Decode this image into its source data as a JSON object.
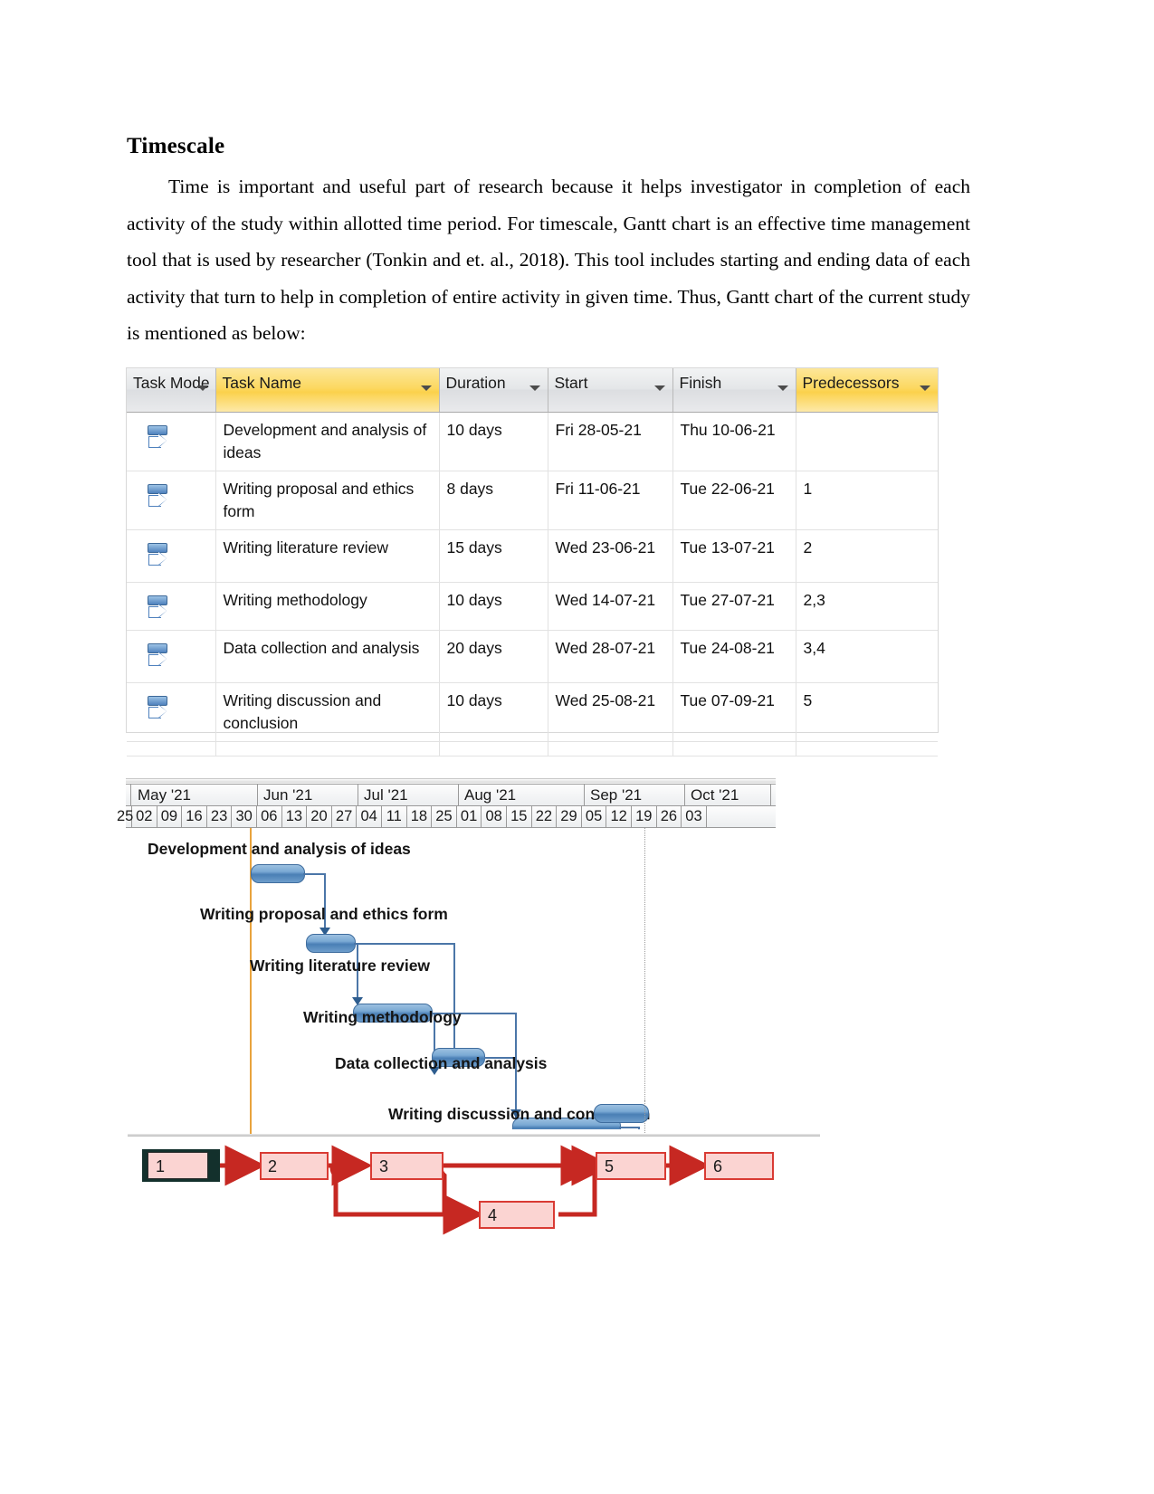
{
  "document": {
    "heading": "Timescale",
    "paragraph": "Time is important and useful part of research because it helps investigator in completion of each activity of the study within allotted time period. For timescale, Gantt chart is an effective time management tool that is used by researcher (Tonkin and et. al., 2018). This tool includes starting and ending data of each activity that turn to help in completion of entire activity in given time. Thus, Gantt chart of the current study is mentioned as below:"
  },
  "task_table": {
    "columns": [
      {
        "label": "Task Mode",
        "style": "gray"
      },
      {
        "label": "Task Name",
        "style": "yellow"
      },
      {
        "label": "Duration",
        "style": "gray"
      },
      {
        "label": "Start",
        "style": "gray"
      },
      {
        "label": "Finish",
        "style": "gray"
      },
      {
        "label": "Predecessors",
        "style": "yellow"
      }
    ],
    "rows": [
      {
        "mode": "auto-schedule",
        "name": "Development and analysis of ideas",
        "duration": "10 days",
        "start": "Fri 28-05-21",
        "finish": "Thu 10-06-21",
        "predecessors": ""
      },
      {
        "mode": "auto-schedule",
        "name": "Writing proposal and ethics form",
        "duration": "8 days",
        "start": "Fri 11-06-21",
        "finish": "Tue 22-06-21",
        "predecessors": "1"
      },
      {
        "mode": "auto-schedule",
        "name": "Writing literature review",
        "duration": "15 days",
        "start": "Wed 23-06-21",
        "finish": "Tue 13-07-21",
        "predecessors": "2"
      },
      {
        "mode": "auto-schedule",
        "name": "Writing methodology",
        "duration": "10 days",
        "start": "Wed 14-07-21",
        "finish": "Tue 27-07-21",
        "predecessors": "2,3"
      },
      {
        "mode": "auto-schedule",
        "name": "Data collection and analysis",
        "duration": "20 days",
        "start": "Wed 28-07-21",
        "finish": "Tue 24-08-21",
        "predecessors": "3,4"
      },
      {
        "mode": "auto-schedule",
        "name": "Writing discussion and conclusion",
        "duration": "10 days",
        "start": "Wed 25-08-21",
        "finish": "Tue 07-09-21",
        "predecessors": "5"
      }
    ]
  },
  "chart_data": {
    "type": "bar",
    "title": "Gantt chart of the current study",
    "xlabel": "",
    "ylabel": "",
    "months": [
      {
        "label": "May '21",
        "weeks": 5
      },
      {
        "label": "Jun '21",
        "weeks": 4
      },
      {
        "label": "Jul '21",
        "weeks": 4
      },
      {
        "label": "Aug '21",
        "weeks": 5
      },
      {
        "label": "Sep '21",
        "weeks": 4
      },
      {
        "label": "Oct '21",
        "weeks": 1
      }
    ],
    "week_ticks": [
      "25",
      "02",
      "09",
      "16",
      "23",
      "30",
      "06",
      "13",
      "20",
      "27",
      "04",
      "11",
      "18",
      "25",
      "01",
      "08",
      "15",
      "22",
      "29",
      "05",
      "12",
      "19",
      "26",
      "03"
    ],
    "categories": [
      "Development and analysis of ideas",
      "Writing proposal and ethics form",
      "Writing literature review",
      "Writing methodology",
      "Data collection and analysis",
      "Writing discussion and conclusion"
    ],
    "values": [
      10,
      8,
      15,
      10,
      20,
      10
    ],
    "bars": [
      {
        "label": "Development and analysis of ideas",
        "start": "Fri 28-05-21",
        "finish": "Thu 10-06-21",
        "duration_days": 10,
        "start_week_index": 4.45,
        "width_weeks": 1.95
      },
      {
        "label": "Writing proposal and ethics form",
        "start": "Fri 11-06-21",
        "finish": "Tue 22-06-21",
        "duration_days": 8,
        "start_week_index": 6.45,
        "width_weeks": 1.6
      },
      {
        "label": "Writing literature review",
        "start": "Wed 23-06-21",
        "finish": "Tue 13-07-21",
        "duration_days": 15,
        "start_week_index": 8.05,
        "width_weeks": 3.0
      },
      {
        "label": "Writing methodology",
        "start": "Wed 14-07-21",
        "finish": "Tue 27-07-21",
        "duration_days": 10,
        "start_week_index": 11.05,
        "width_weeks": 2.0
      },
      {
        "label": "Data collection and analysis",
        "start": "Wed 28-07-21",
        "finish": "Tue 24-08-21",
        "duration_days": 20,
        "start_week_index": 13.05,
        "width_weeks": 4.0
      },
      {
        "label": "Writing discussion and conclusion",
        "start": "Wed 25-08-21",
        "finish": "Tue 07-09-21",
        "duration_days": 10,
        "start_week_index": 17.05,
        "width_weeks": 2.0
      }
    ],
    "bar_color": "#4a7fb5",
    "link_color": "#4b76a8",
    "today_line_color": "#e8a33d",
    "grid": false,
    "legend": "none"
  },
  "network_diagram": {
    "node_fill": "#fbd4d2",
    "node_border": "#d93b34",
    "nodes": [
      {
        "id": "1",
        "label": "1",
        "critical_start": true
      },
      {
        "id": "2",
        "label": "2"
      },
      {
        "id": "3",
        "label": "3"
      },
      {
        "id": "4",
        "label": "4"
      },
      {
        "id": "5",
        "label": "5"
      },
      {
        "id": "6",
        "label": "6"
      }
    ],
    "edges": [
      {
        "from": "1",
        "to": "2"
      },
      {
        "from": "2",
        "to": "3"
      },
      {
        "from": "2",
        "to": "4"
      },
      {
        "from": "3",
        "to": "4"
      },
      {
        "from": "3",
        "to": "5"
      },
      {
        "from": "4",
        "to": "5"
      },
      {
        "from": "5",
        "to": "6"
      }
    ]
  }
}
